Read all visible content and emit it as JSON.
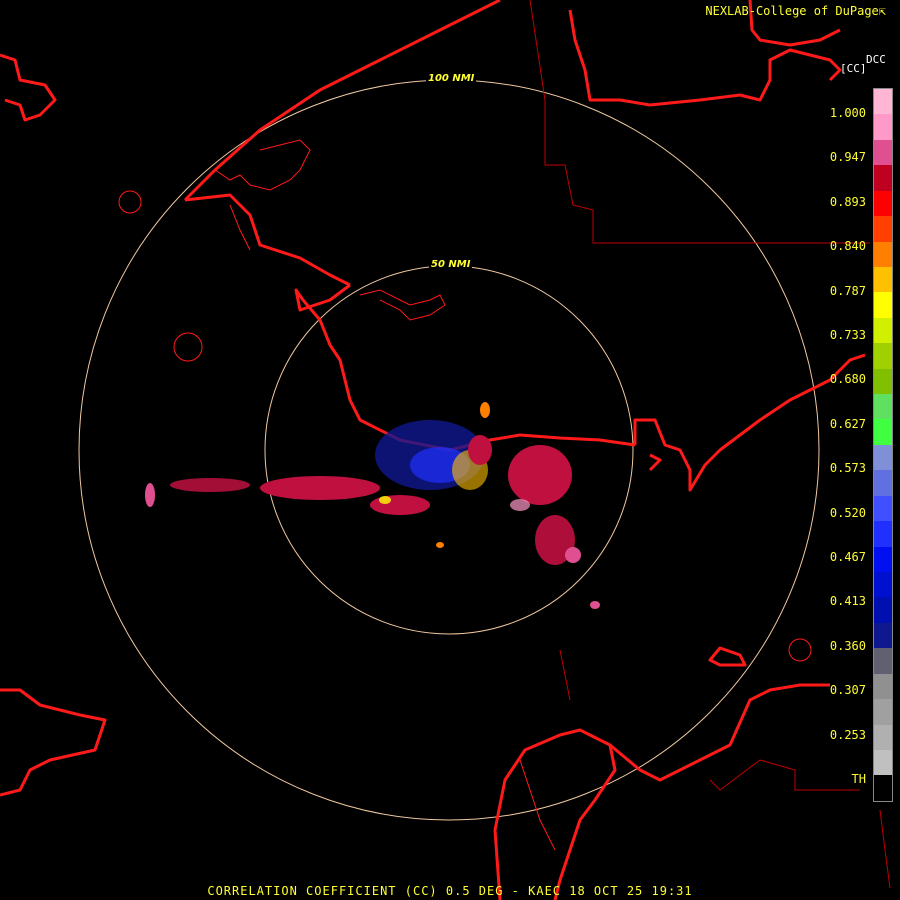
{
  "header": {
    "credit": "NEXLAB-College of DuPage",
    "credit_icon": "arrow-icon"
  },
  "legend": {
    "unit_code": "DCC",
    "unit_label": "[CC]",
    "ticks": [
      "1.000",
      "0.947",
      "0.893",
      "0.840",
      "0.787",
      "0.733",
      "0.680",
      "0.627",
      "0.573",
      "0.520",
      "0.467",
      "0.413",
      "0.360",
      "0.307",
      "0.253",
      "TH"
    ],
    "colors": [
      "#ffb6d5",
      "#ff99c8",
      "#e05090",
      "#c00020",
      "#ff0000",
      "#ff4000",
      "#ff8000",
      "#ffc000",
      "#ffff00",
      "#d0f000",
      "#a0d000",
      "#80c000",
      "#60e060",
      "#40ff40",
      "#8090d8",
      "#6070e0",
      "#4050ff",
      "#2030ff",
      "#0010f0",
      "#0010d0",
      "#0010b0",
      "#101890",
      "#606070",
      "#909090",
      "#a0a0a0",
      "#b0b0b0",
      "#c0c0c0",
      "#000000"
    ]
  },
  "range_rings": {
    "inner": "50 NMI",
    "outer": "100 NMI"
  },
  "footer": {
    "product": "CORRELATION COEFFICIENT (CC) 0.5 DEG - KAEC 18 OCT 25 19:31"
  },
  "colors": {
    "coast": "#ff1a1a",
    "ring": "#f0c8a0",
    "border": "#c00000",
    "text": "#ffff33"
  }
}
